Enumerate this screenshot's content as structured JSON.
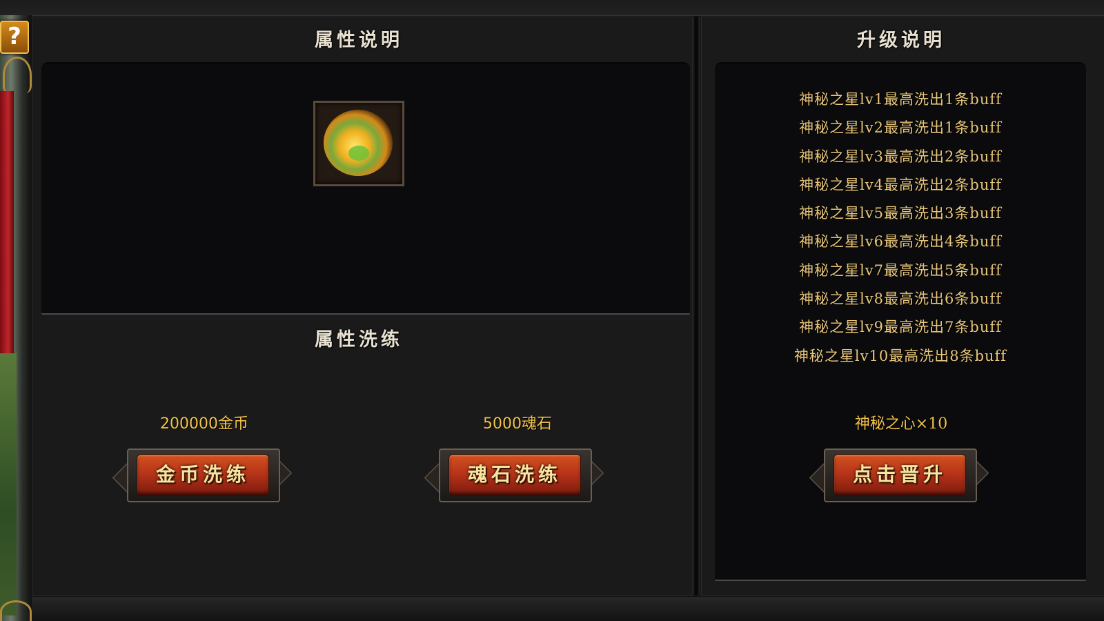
{
  "help_button": {
    "label": "?"
  },
  "attribute_panel": {
    "title": "属性说明",
    "item_icon": "mystic-star-orb-icon"
  },
  "refine_panel": {
    "title": "属性洗练",
    "gold": {
      "cost": "200000金币",
      "button_label": "金币洗练"
    },
    "soul": {
      "cost": "5000魂石",
      "button_label": "魂石洗练"
    }
  },
  "upgrade_panel": {
    "title": "升级说明",
    "levels": [
      "神秘之星lv1最高洗出1条buff",
      "神秘之星lv2最高洗出1条buff",
      "神秘之星lv3最高洗出2条buff",
      "神秘之星lv4最高洗出2条buff",
      "神秘之星lv5最高洗出3条buff",
      "神秘之星lv6最高洗出4条buff",
      "神秘之星lv7最高洗出5条buff",
      "神秘之星lv8最高洗出6条buff",
      "神秘之星lv9最高洗出7条buff",
      "神秘之星lv10最高洗出8条buff"
    ],
    "cost": "神秘之心×10",
    "button_label": "点击晋升"
  },
  "colors": {
    "panel_bg": "#1a1a1a",
    "title_text": "#e8e1d2",
    "buff_text": "#e8c67a",
    "cost_text": "#f2c24a",
    "button_face": "#b8351a",
    "button_text": "#f7e6a0"
  }
}
